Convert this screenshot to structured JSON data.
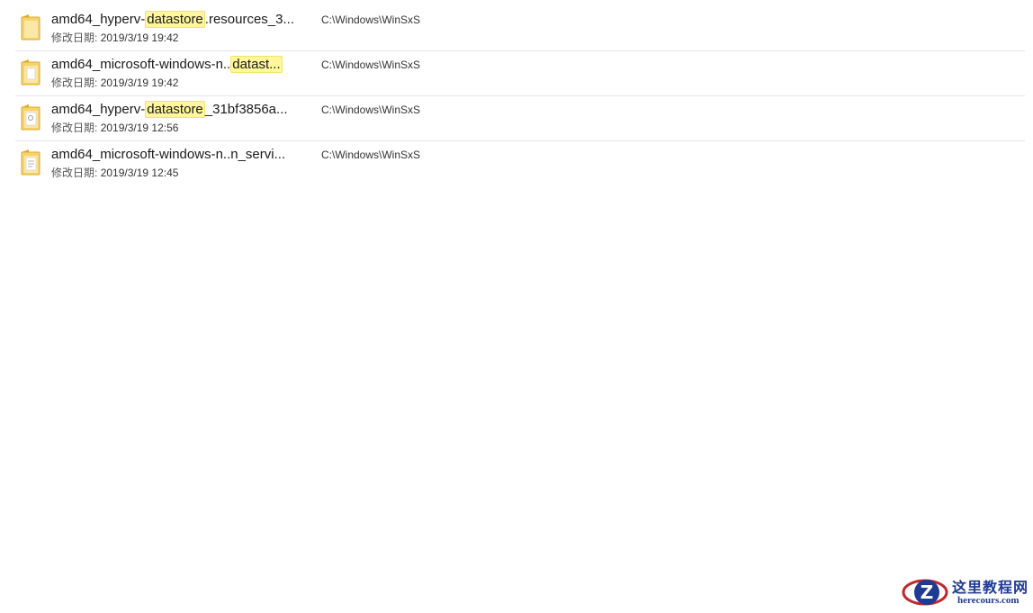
{
  "results": [
    {
      "name_before": "amd64_hyperv-",
      "name_match": "datastore",
      "name_after": ".resources_3...",
      "meta_label": "修改日期:",
      "date": "2019/3/19 19:42",
      "path": "C:\\Windows\\WinSxS",
      "icon": "folder-icon"
    },
    {
      "name_before": "amd64_microsoft-windows-n..",
      "name_match": "datast...",
      "name_after": "",
      "meta_label": "修改日期:",
      "date": "2019/3/19 19:42",
      "path": "C:\\Windows\\WinSxS",
      "icon": "folder-icon"
    },
    {
      "name_before": "amd64_hyperv-",
      "name_match": "datastore",
      "name_after": "_31bf3856a...",
      "meta_label": "修改日期:",
      "date": "2019/3/19 12:56",
      "path": "C:\\Windows\\WinSxS",
      "icon": "folder-icon"
    },
    {
      "name_before": "amd64_microsoft-windows-n..n_servi...",
      "name_match": "",
      "name_after": "",
      "meta_label": "修改日期:",
      "date": "2019/3/19 12:45",
      "path": "C:\\Windows\\WinSxS",
      "icon": "folder-icon"
    }
  ],
  "colors": {
    "highlight": "#fff79a",
    "folder": "#f5c542",
    "separator": "#e5e5e5",
    "watermark": "#1f3a93"
  },
  "watermark": {
    "title": "这里教程网",
    "url": "herecours.com",
    "logo_letter": "Z"
  }
}
